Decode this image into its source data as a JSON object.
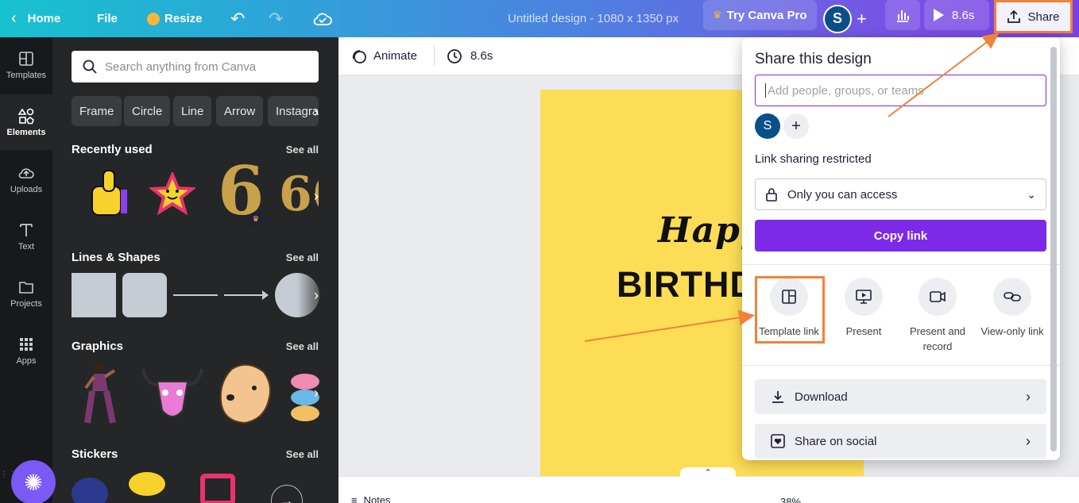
{
  "topbar": {
    "home": "Home",
    "file": "File",
    "resize": "Resize",
    "title": "Untitled design - 1080 x 1350 px",
    "try_pro": "Try Canva Pro",
    "avatar_initial": "S",
    "play_time": "8.6s",
    "share": "Share"
  },
  "rail": {
    "items": [
      {
        "label": "Templates",
        "icon": "templates-icon"
      },
      {
        "label": "Elements",
        "icon": "elements-icon"
      },
      {
        "label": "Uploads",
        "icon": "uploads-icon"
      },
      {
        "label": "Text",
        "icon": "text-icon"
      },
      {
        "label": "Projects",
        "icon": "folder-icon"
      },
      {
        "label": "Apps",
        "icon": "apps-icon"
      }
    ]
  },
  "panel": {
    "search_placeholder": "Search anything from Canva",
    "chips": [
      "Frame",
      "Circle",
      "Line",
      "Arrow",
      "Instagra"
    ],
    "sections": {
      "recently_used": "Recently used",
      "lines_shapes": "Lines & Shapes",
      "graphics": "Graphics",
      "stickers": "Stickers"
    },
    "see_all": "See all"
  },
  "toolbar": {
    "animate": "Animate",
    "duration": "8.6s"
  },
  "design": {
    "line1": "Happy",
    "line2": "BIRTHD"
  },
  "bottom": {
    "notes": "Notes",
    "zoom": "38%"
  },
  "share_panel": {
    "title": "Share this design",
    "input_placeholder": "Add people, groups, or teams",
    "avatar_initial": "S",
    "link_label": "Link sharing restricted",
    "access_value": "Only you can access",
    "copy_link": "Copy link",
    "options": [
      {
        "label": "Template link",
        "icon": "template-link-icon"
      },
      {
        "label": "Present",
        "icon": "present-icon"
      },
      {
        "label": "Present and record",
        "icon": "present-record-icon"
      },
      {
        "label": "View-only link",
        "icon": "view-only-link-icon"
      }
    ],
    "download": "Download",
    "share_social": "Share on social"
  },
  "colors": {
    "accent_purple": "#7d2ae8",
    "highlight_orange": "#f0823a",
    "design_yellow": "#fddd55"
  }
}
